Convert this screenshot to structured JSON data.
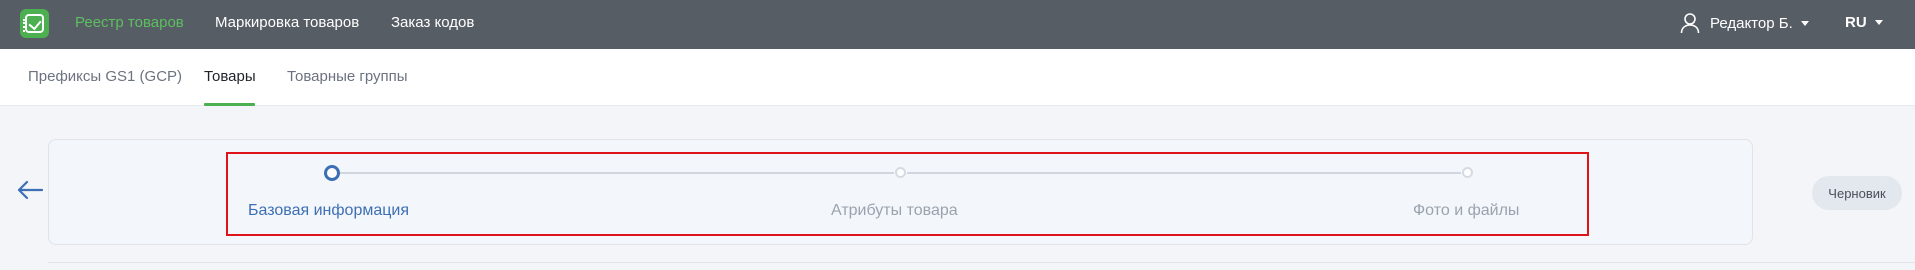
{
  "header": {
    "nav": [
      {
        "label": "Реестр товаров",
        "active": true
      },
      {
        "label": "Маркировка товаров",
        "active": false
      },
      {
        "label": "Заказ кодов",
        "active": false
      }
    ],
    "user_name": "Редактор Б.",
    "language": "RU"
  },
  "subnav": {
    "tabs": [
      {
        "label": "Префиксы GS1 (GCP)",
        "active": false
      },
      {
        "label": "Товары",
        "active": true
      },
      {
        "label": "Товарные группы",
        "active": false
      }
    ]
  },
  "stepper": {
    "steps": [
      {
        "label": "Базовая информация",
        "state": "current"
      },
      {
        "label": "Атрибуты товара",
        "state": "pending"
      },
      {
        "label": "Фото и файлы",
        "state": "pending"
      }
    ]
  },
  "status_badge": "Черновик",
  "colors": {
    "topbar_bg": "#575d64",
    "brand_green": "#4caf50",
    "step_active": "#3d6fb5",
    "highlight_border": "#e0131b"
  },
  "icons": {
    "logo": "checklist-logo-icon",
    "user": "user-icon",
    "caret": "caret-down-icon",
    "back": "arrow-left-icon"
  }
}
